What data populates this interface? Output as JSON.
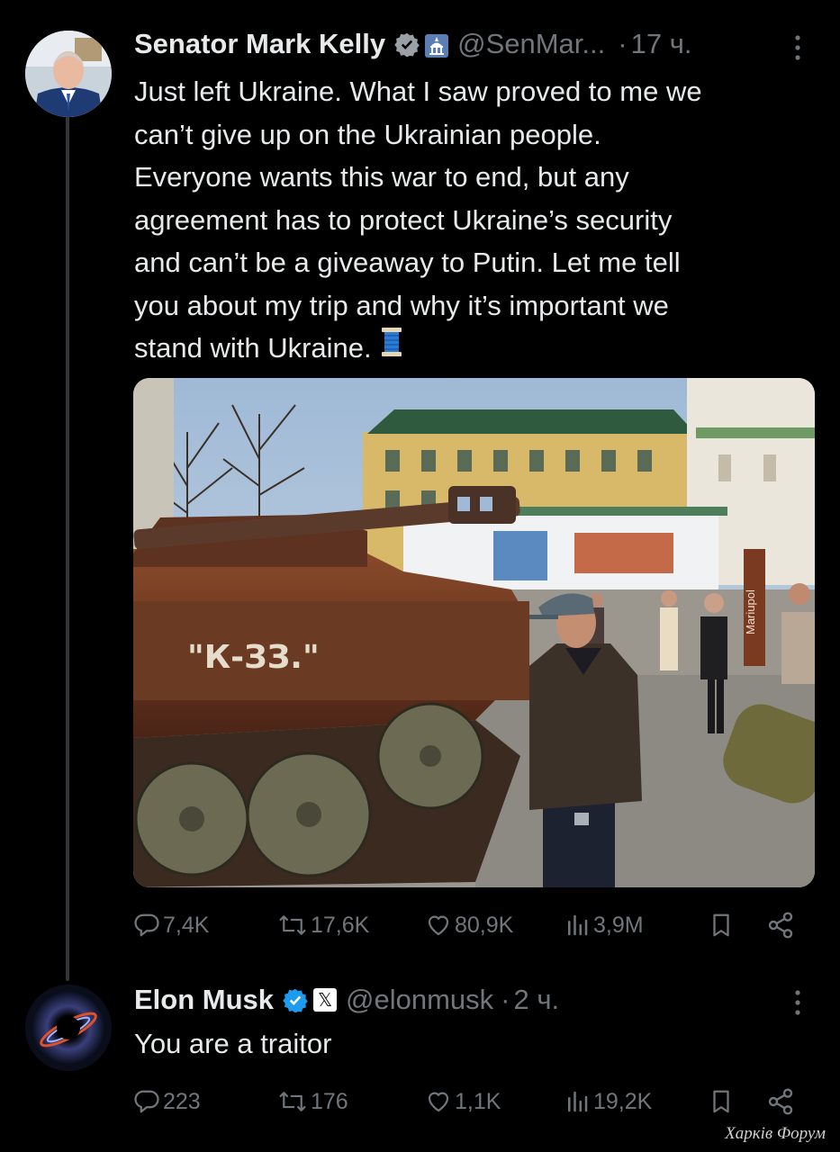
{
  "tweet": {
    "author_name": "Senator Mark Kelly",
    "handle": "@SenMar...",
    "separator": "·",
    "time": "17 ч.",
    "text_lines": [
      "Just left Ukraine. What I saw proved to me we",
      "can’t give up on the Ukrainian people.",
      "Everyone wants this war to end, but any",
      "agreement has to protect Ukraine’s security",
      "and can’t be a giveaway to Putin. Let me tell",
      "you about my trip and why it’s important we",
      "stand with Ukraine."
    ],
    "emoji": "spool-of-thread",
    "media": {
      "sign_text": "Mariupol",
      "tank_text": "\"К-ЗЗ.\""
    },
    "stats": {
      "replies": "7,4K",
      "reposts": "17,6K",
      "likes": "80,9K",
      "views": "3,9M"
    }
  },
  "reply": {
    "author_name": "Elon Musk",
    "affiliate_badge": "𝕏",
    "handle": "@elonmusk",
    "separator": "·",
    "time": "2 ч.",
    "text": "You are a traitor",
    "stats": {
      "replies": "223",
      "reposts": "176",
      "likes": "1,1K",
      "views": "19,2K"
    }
  },
  "watermark": "Харків Форум",
  "colors": {
    "background": "#000000",
    "text": "#e7e9ea",
    "muted": "#71767b",
    "verified": "#1d9bf0"
  }
}
